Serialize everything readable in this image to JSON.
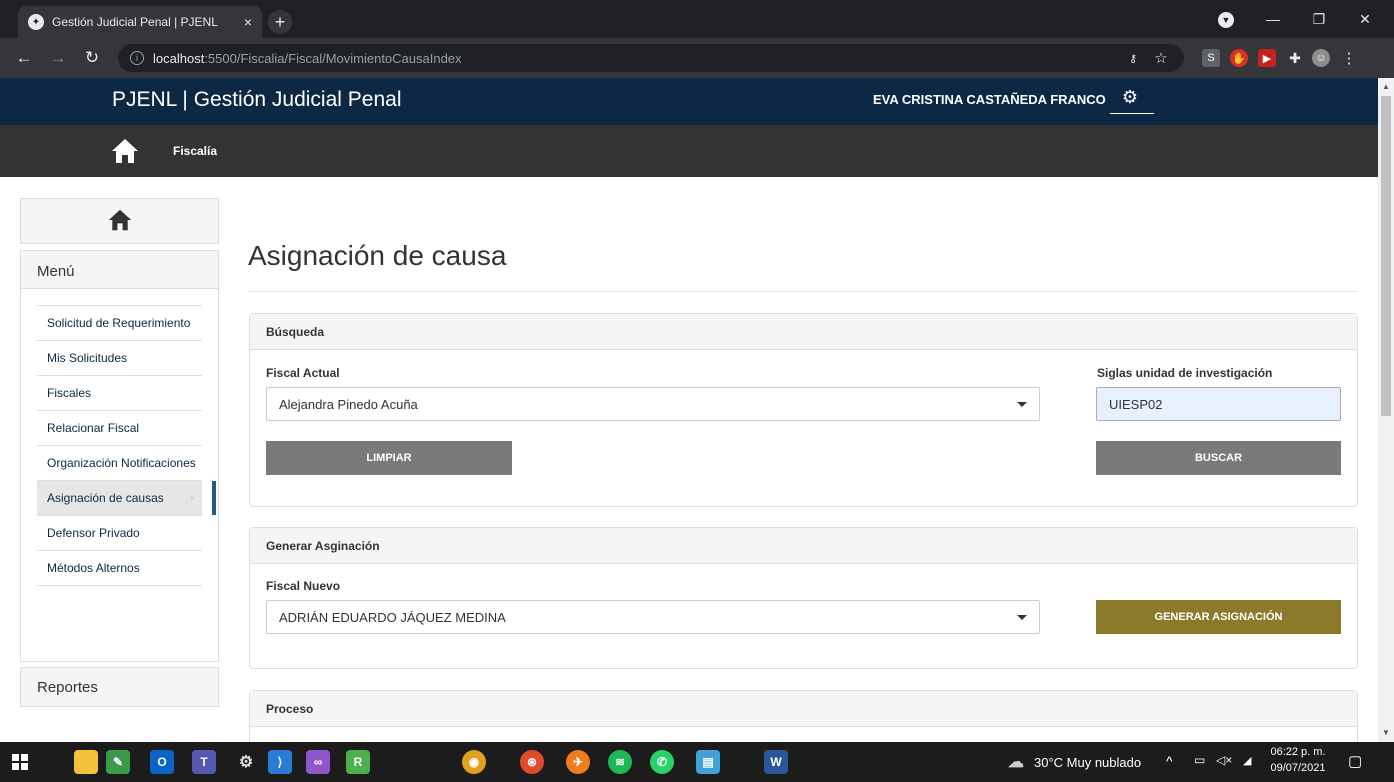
{
  "browser": {
    "tab_title": "Gestión Judicial Penal | PJENL",
    "tab_close": "×",
    "new_tab": "+",
    "url_host": "localhost",
    "url_rest": ":5500/Fiscalia/Fiscal/MovimientoCausaIndex",
    "minimize": "—",
    "restore": "❐",
    "close": "✕"
  },
  "header": {
    "brand": "PJENL  |  Gestión Judicial Penal",
    "user": "EVA CRISTINA CASTAÑEDA FRANCO"
  },
  "subnav": {
    "label": "Fiscalía"
  },
  "sidebar": {
    "menu_title": "Menú",
    "items": [
      {
        "label": "Solicitud de Requerimiento"
      },
      {
        "label": "Mis Solicitudes"
      },
      {
        "label": "Fiscales"
      },
      {
        "label": "Relacionar Fiscal"
      },
      {
        "label": "Organización Notificaciones"
      },
      {
        "label": "Asignación de causas",
        "active": true
      },
      {
        "label": "Defensor Privado"
      },
      {
        "label": "Métodos Alternos"
      }
    ],
    "reports_title": "Reportes"
  },
  "main": {
    "title": "Asignación de causa",
    "busqueda": {
      "heading": "Búsqueda",
      "fiscal_label": "Fiscal Actual",
      "fiscal_value": "Alejandra Pinedo Acuña",
      "siglas_label": "Siglas unidad de investigación",
      "siglas_value": "UIESP02",
      "clear_button": "LIMPIAR",
      "search_button": "BUSCAR"
    },
    "generar": {
      "heading": "Generar Asginación",
      "fiscal_label": "Fiscal Nuevo",
      "fiscal_value": "ADRIÁN EDUARDO JÁQUEZ MEDINA",
      "generate_button": "GENERAR ASIGNACIÓN"
    },
    "proceso": {
      "heading": "Proceso"
    }
  },
  "taskbar": {
    "weather": "30°C  Muy nublado",
    "time": "06:22 p. m.",
    "date": "09/07/2021"
  },
  "colors": {
    "header_bg": "#0d2845",
    "subnav_bg": "#333333",
    "gold_button": "#8c7a2b",
    "gray_button": "#7a7a7a"
  }
}
